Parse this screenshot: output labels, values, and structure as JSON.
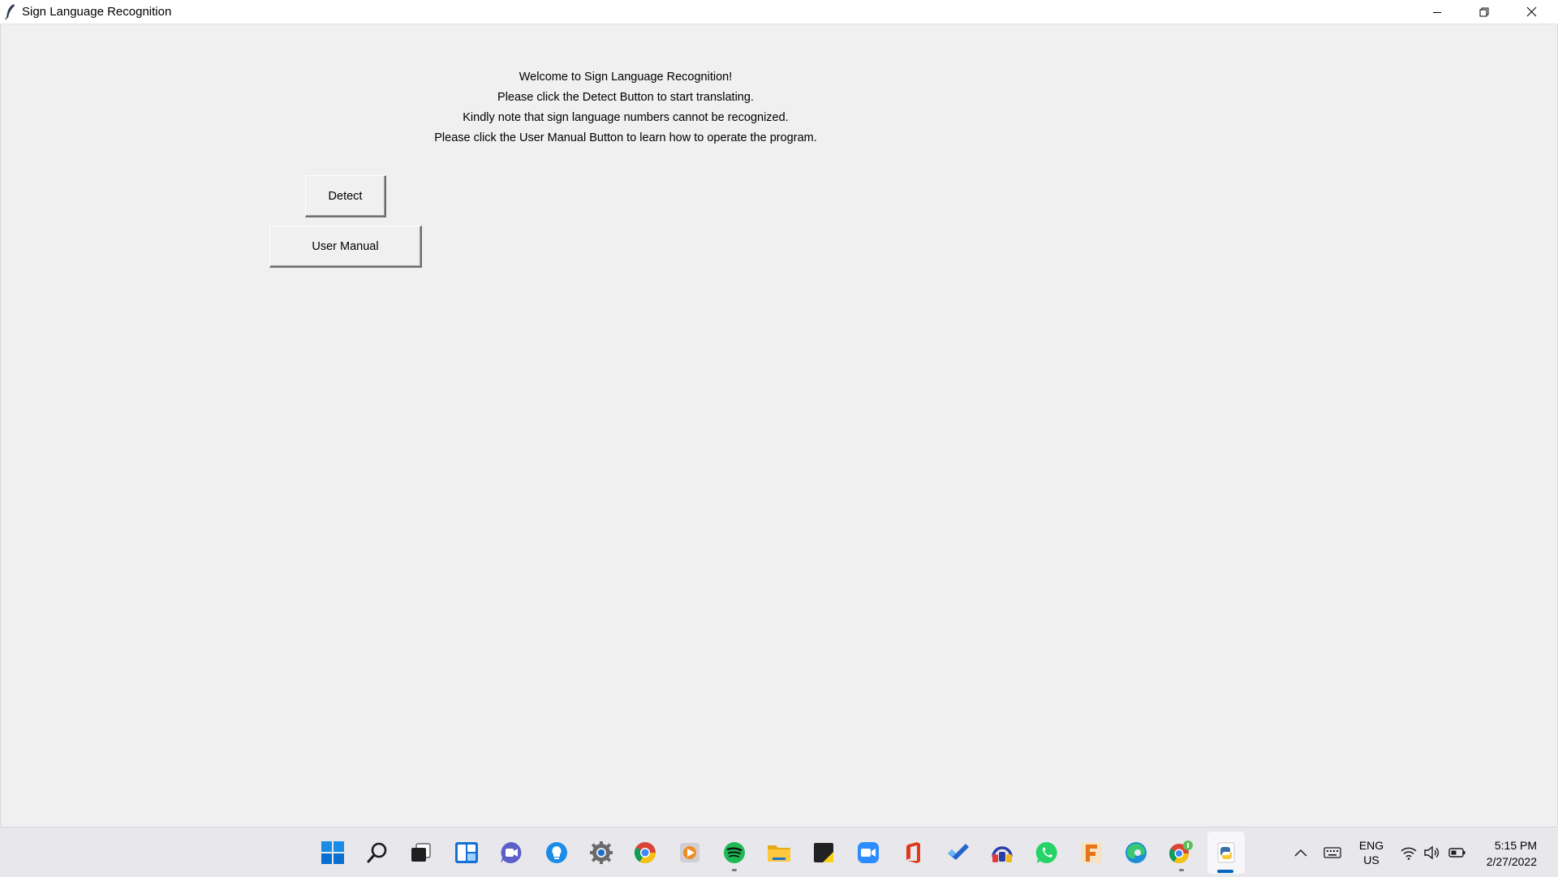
{
  "window": {
    "title": "Sign Language Recognition",
    "controls": [
      "minimize",
      "restore",
      "close"
    ]
  },
  "main": {
    "welcome_lines": [
      "Welcome to Sign Language Recognition!",
      "Please click the Detect Button to start translating.",
      "Kindly note that sign language numbers cannot be recognized.",
      "Please click the User Manual Button to learn how to operate the program."
    ],
    "detect_label": "Detect",
    "user_manual_label": "User Manual"
  },
  "taskbar": {
    "apps": [
      "start-icon",
      "search-icon",
      "task-view-icon",
      "widgets-icon",
      "teams-chat-icon",
      "ideas-bulb-icon",
      "settings-gear-icon",
      "chrome-icon",
      "media-player-icon",
      "spotify-icon",
      "file-explorer-icon",
      "sticky-notes-icon",
      "zoom-icon",
      "office-icon",
      "todo-icon",
      "headphones-app-icon",
      "whatsapp-icon",
      "fl-app-icon",
      "edge-icon",
      "chrome-profile-icon",
      "python-icon"
    ],
    "language_line1": "ENG",
    "language_line2": "US",
    "time": "5:15 PM",
    "date": "2/27/2022"
  },
  "colors": {
    "window_bg": "#f0f0f0",
    "taskbar_bg": "#e8e8ec",
    "accent": "#0067c0"
  }
}
